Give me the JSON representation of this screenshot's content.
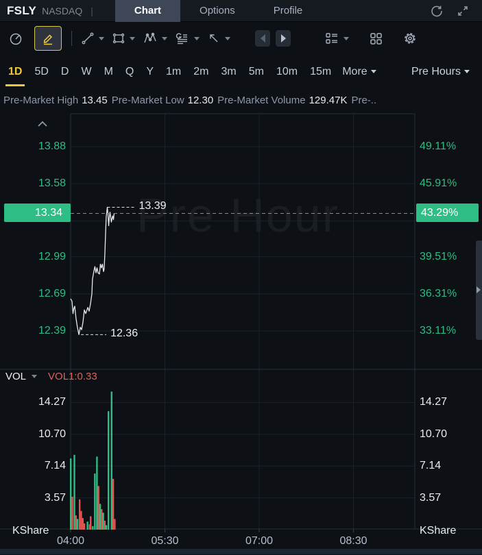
{
  "window": {
    "symbol": "FSLY",
    "exchange": "NASDAQ",
    "separator": "|",
    "tabs": [
      {
        "label": "Chart",
        "active": true
      },
      {
        "label": "Options",
        "active": false
      },
      {
        "label": "Profile",
        "active": false
      }
    ],
    "icons": [
      "refresh-icon",
      "fullscreen-icon"
    ]
  },
  "toolbar": {
    "icons": [
      "gauge-icon",
      "draw-pencil-icon",
      "trend-line-icon",
      "rectangle-shape-icon",
      "wave-pattern-icon",
      "text-lines-icon",
      "arrow-cursor-icon",
      "prev-arrow-icon",
      "next-arrow-icon",
      "list-settings-icon",
      "grid-layout-icon",
      "gear-icon"
    ],
    "active_icon": "draw-pencil-icon"
  },
  "timeframe_bar": {
    "items": [
      "1D",
      "5D",
      "D",
      "W",
      "M",
      "Q",
      "Y",
      "1m",
      "2m",
      "3m",
      "5m",
      "10m",
      "15m"
    ],
    "active": "1D",
    "more_label": "More",
    "session_label": "Pre Hours"
  },
  "info_bar": {
    "stats": [
      {
        "label": "Pre-Market High",
        "value": "13.45"
      },
      {
        "label": "Pre-Market Low",
        "value": "12.30"
      },
      {
        "label": "Pre-Market Volume",
        "value": "129.47K"
      }
    ],
    "truncated_tail": "Pre-.."
  },
  "volume_header": {
    "label": "VOL",
    "indicator": "VOL1:0.33"
  },
  "chart_data": {
    "type": "line",
    "title": "FSLY pre-market intraday price with volume",
    "watermark": "Pre Hour",
    "unit_label": "KShare",
    "current": {
      "price": 13.34,
      "price_label": "13.34",
      "pct_label": "43.29%"
    },
    "high_annotation": {
      "price": 13.39,
      "label": "13.39",
      "minute": 35
    },
    "low_annotation": {
      "price": 12.36,
      "label": "12.36",
      "minute": 7.9
    },
    "y_ticks": [
      {
        "price": 13.88,
        "price_label": "13.88",
        "pct_label": "49.11%"
      },
      {
        "price": 13.58,
        "price_label": "13.58",
        "pct_label": "45.91%"
      },
      {
        "price": 13.28,
        "price_label": null,
        "pct_label": null
      },
      {
        "price": 12.99,
        "price_label": "12.99",
        "pct_label": "39.51%"
      },
      {
        "price": 12.69,
        "price_label": "12.69",
        "pct_label": "36.31%"
      },
      {
        "price": 12.39,
        "price_label": "12.39",
        "pct_label": "33.11%"
      }
    ],
    "vol_ticks": [
      {
        "value": 14.27,
        "label": "14.27"
      },
      {
        "value": 10.7,
        "label": "10.70"
      },
      {
        "value": 7.14,
        "label": "7.14"
      },
      {
        "value": 3.57,
        "label": "3.57"
      }
    ],
    "x_ticks": [
      {
        "minute": 0,
        "label": "04:00"
      },
      {
        "minute": 90,
        "label": "05:30"
      },
      {
        "minute": 180,
        "label": "07:00"
      },
      {
        "minute": 270,
        "label": "08:30"
      }
    ],
    "x_range_minutes": [
      0,
      328
    ],
    "price_series": [
      [
        0,
        12.65
      ],
      [
        1.3,
        12.63
      ],
      [
        2.3,
        12.53
      ],
      [
        3,
        12.57
      ],
      [
        3.9,
        12.59
      ],
      [
        5.2,
        12.49
      ],
      [
        6.5,
        12.42
      ],
      [
        7.9,
        12.36
      ],
      [
        9.2,
        12.42
      ],
      [
        10.5,
        12.4
      ],
      [
        11.8,
        12.46
      ],
      [
        13.1,
        12.56
      ],
      [
        14.4,
        12.53
      ],
      [
        16.4,
        12.58
      ],
      [
        17.7,
        12.55
      ],
      [
        19,
        12.61
      ],
      [
        20.3,
        12.69
      ],
      [
        20.9,
        12.81
      ],
      [
        22.2,
        12.87
      ],
      [
        23.2,
        12.91
      ],
      [
        24.2,
        12.86
      ],
      [
        25.2,
        12.9
      ],
      [
        26.2,
        12.86
      ],
      [
        27.5,
        12.85
      ],
      [
        28.5,
        12.93
      ],
      [
        29.4,
        12.9
      ],
      [
        30.4,
        12.93
      ],
      [
        31.4,
        12.87
      ],
      [
        32,
        12.89
      ],
      [
        32.7,
        13.02
      ],
      [
        33.4,
        13.18
      ],
      [
        34,
        13.31
      ],
      [
        35,
        13.39
      ],
      [
        35.7,
        13.33
      ],
      [
        36.3,
        13.24
      ],
      [
        37,
        13.31
      ],
      [
        37.6,
        13.35
      ],
      [
        38.3,
        13.31
      ],
      [
        38.9,
        13.27
      ],
      [
        39.6,
        13.3
      ],
      [
        40.2,
        13.32
      ],
      [
        40.9,
        13.29
      ],
      [
        41.5,
        13.34
      ]
    ],
    "volume_series": [
      {
        "m": 0,
        "v": 8.0,
        "up": true
      },
      {
        "m": 1.5,
        "v": 3.7,
        "up": false
      },
      {
        "m": 3.5,
        "v": 8.4,
        "up": true
      },
      {
        "m": 5,
        "v": 1.6,
        "up": false
      },
      {
        "m": 6.5,
        "v": 1.2,
        "up": true
      },
      {
        "m": 8.5,
        "v": 3.4,
        "up": false
      },
      {
        "m": 10,
        "v": 2.1,
        "up": false
      },
      {
        "m": 11.5,
        "v": 1.3,
        "up": false
      },
      {
        "m": 13,
        "v": 0.7,
        "up": false
      },
      {
        "m": 16,
        "v": 0.9,
        "up": true
      },
      {
        "m": 18,
        "v": 0.6,
        "up": false
      },
      {
        "m": 19,
        "v": 1.5,
        "up": false
      },
      {
        "m": 21,
        "v": 0.4,
        "up": true
      },
      {
        "m": 23,
        "v": 6.3,
        "up": true
      },
      {
        "m": 25,
        "v": 8.2,
        "up": true
      },
      {
        "m": 26.5,
        "v": 4.9,
        "up": false
      },
      {
        "m": 28,
        "v": 2.9,
        "up": true
      },
      {
        "m": 29.5,
        "v": 2.3,
        "up": false
      },
      {
        "m": 31,
        "v": 1.9,
        "up": true
      },
      {
        "m": 32.5,
        "v": 1.0,
        "up": false
      },
      {
        "m": 34,
        "v": 0.5,
        "up": true
      },
      {
        "m": 36,
        "v": 13.3,
        "up": true
      },
      {
        "m": 39,
        "v": 15.5,
        "up": true
      },
      {
        "m": 40.5,
        "v": 5.7,
        "up": false
      },
      {
        "m": 42,
        "v": 1.2,
        "up": false
      }
    ],
    "legend_position": "none",
    "grid": true
  },
  "colors": {
    "up_green": "#2ebd85",
    "down_red": "#e15550",
    "accent_yellow": "#f0c83c",
    "line_white": "#e6e9ed",
    "indicator_red": "#e0635a",
    "grid": "#1c222d",
    "border": "#28303c"
  }
}
